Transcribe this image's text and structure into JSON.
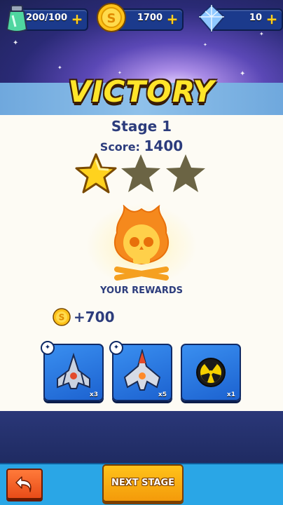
{
  "resources": {
    "energy": {
      "value": "200/100",
      "icon": "energy-potion-icon"
    },
    "coins": {
      "value": "1700",
      "icon": "gold-coin-icon"
    },
    "gems": {
      "value": "10",
      "icon": "diamond-icon"
    },
    "plus_label": "+"
  },
  "result": {
    "title": "VICTORY",
    "stage": "Stage 1",
    "score_label": "Score: ",
    "score_value": "1400",
    "stars_earned": 1,
    "stars_total": 3
  },
  "rewards": {
    "label": "YOUR REWARDS",
    "coins_amount": "+700",
    "items": [
      {
        "icon": "fighter-ship-icon",
        "count": "x3"
      },
      {
        "icon": "heavy-ship-icon",
        "count": "x5"
      },
      {
        "icon": "radiation-bomb-icon",
        "count": "x1"
      }
    ]
  },
  "footer": {
    "next_label": "NEXT STAGE"
  },
  "colors": {
    "title_yellow": "#ffe52a",
    "text_navy": "#2c3c7c",
    "button_orange": "#f49a0a",
    "bar_blue": "#2aa6e6"
  }
}
